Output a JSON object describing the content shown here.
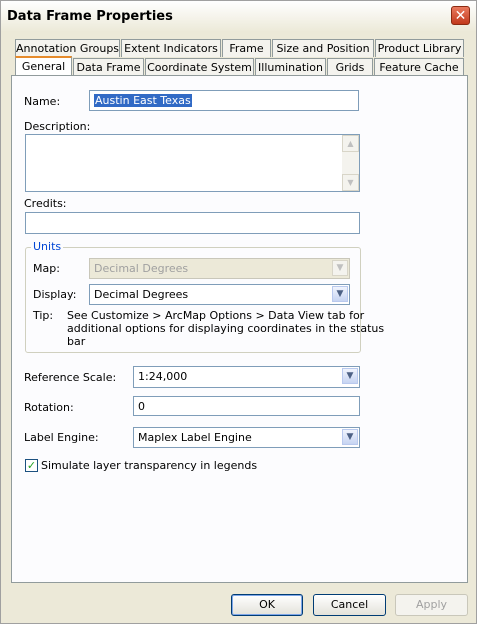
{
  "window": {
    "title": "Data Frame Properties",
    "close_glyph": "✕"
  },
  "tabs_row1": [
    "Annotation Groups",
    "Extent Indicators",
    "Frame",
    "Size and Position",
    "Product Library"
  ],
  "tabs_row2": [
    "General",
    "Data Frame",
    "Coordinate System",
    "Illumination",
    "Grids",
    "Feature Cache"
  ],
  "active_tab": "General",
  "general": {
    "name_label": "Name:",
    "name_value": "Austin East Texas",
    "description_label": "Description:",
    "description_value": "",
    "credits_label": "Credits:",
    "credits_value": ""
  },
  "units": {
    "group_title": "Units",
    "map_label": "Map:",
    "map_value": "Decimal Degrees",
    "display_label": "Display:",
    "display_value": "Decimal Degrees",
    "tip_label": "Tip:",
    "tip_line1": "See Customize > ArcMap Options > Data View tab for",
    "tip_line2": "additional options for displaying coordinates in the status",
    "tip_line3": "bar"
  },
  "reference_scale": {
    "label": "Reference Scale:",
    "value": "1:24,000"
  },
  "rotation": {
    "label": "Rotation:",
    "value": "0"
  },
  "label_engine": {
    "label": "Label Engine:",
    "value": "Maplex Label Engine"
  },
  "simulate_transparency": {
    "label": "Simulate layer transparency in legends",
    "checked": true
  },
  "buttons": {
    "ok": "OK",
    "cancel": "Cancel",
    "apply": "Apply"
  },
  "icons": {
    "dropdown_arrow": "▼",
    "scroll_up": "▲",
    "scroll_down": "▼",
    "check": "✓"
  }
}
